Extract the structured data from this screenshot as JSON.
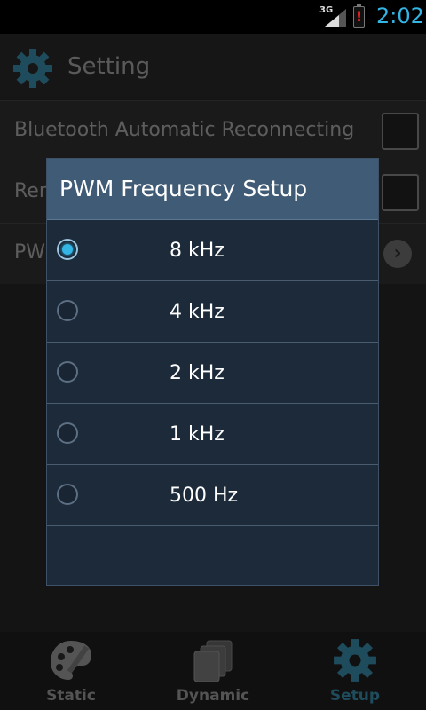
{
  "status_bar": {
    "network": "3G",
    "time": "2:02"
  },
  "header": {
    "title": "Setting"
  },
  "settings_rows": [
    {
      "label": "Bluetooth Automatic Reconnecting"
    },
    {
      "label": "Ren"
    },
    {
      "label": "PW"
    }
  ],
  "dialog": {
    "title": "PWM Frequency Setup",
    "options": [
      {
        "label": "8 kHz",
        "selected": true
      },
      {
        "label": "4 kHz",
        "selected": false
      },
      {
        "label": "2 kHz",
        "selected": false
      },
      {
        "label": "1 kHz",
        "selected": false
      },
      {
        "label": "500 Hz",
        "selected": false
      }
    ]
  },
  "bottom_nav": [
    {
      "label": "Static",
      "icon": "palette-icon",
      "active": false
    },
    {
      "label": "Dynamic",
      "icon": "stacked-pages-icon",
      "active": false
    },
    {
      "label": "Setup",
      "icon": "gear-icon",
      "active": true
    }
  ],
  "colors": {
    "accent": "#33b5e5",
    "dialog_header": "#3f5b75",
    "dialog_body": "#1c2a3a"
  }
}
